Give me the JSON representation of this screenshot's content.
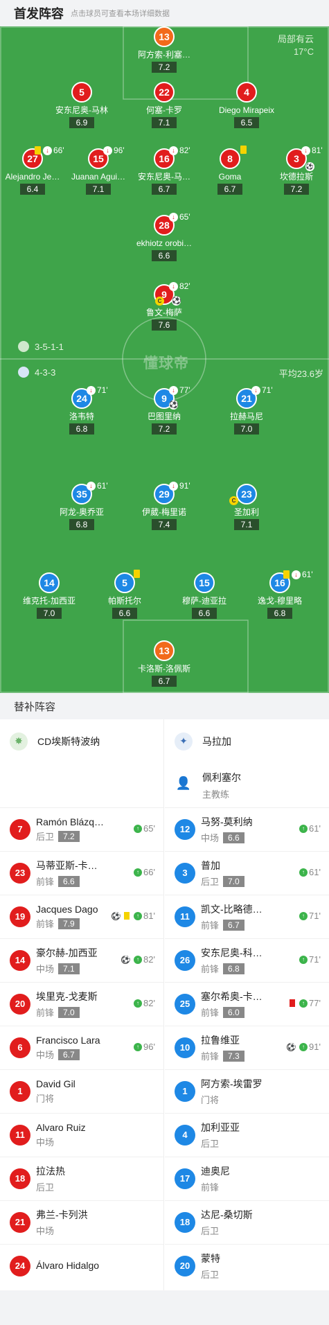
{
  "header": {
    "title": "首发阵容",
    "hint": "点击球员可查看本场详细数据"
  },
  "weather": {
    "condition": "局部有云",
    "temp": "17°C"
  },
  "home": {
    "formation": "3-5-1-1",
    "players": [
      {
        "num": "13",
        "name": "阿方索-利塞…",
        "rating": "7.2",
        "color": "orange"
      },
      {
        "num": "5",
        "name": "安东尼奥-马林",
        "rating": "6.9"
      },
      {
        "num": "22",
        "name": "何塞-卡罗",
        "rating": "7.1"
      },
      {
        "num": "4",
        "name": "Diego Mirapeix",
        "rating": "6.5"
      },
      {
        "num": "27",
        "name": "Alejandro Je…",
        "rating": "6.4",
        "min": "66'"
      },
      {
        "num": "15",
        "name": "Juanan Agui…",
        "rating": "7.1",
        "min": "96'"
      },
      {
        "num": "16",
        "name": "安东尼奥-马…",
        "rating": "6.7",
        "min": "82'"
      },
      {
        "num": "8",
        "name": "Goma",
        "rating": "6.7"
      },
      {
        "num": "3",
        "name": "坎德拉斯",
        "rating": "7.2",
        "min": "81'"
      },
      {
        "num": "28",
        "name": "ekhiotz orobi…",
        "rating": "6.6",
        "min": "65'"
      },
      {
        "num": "9",
        "name": "鲁文-梅萨",
        "rating": "7.6",
        "min": "82'"
      }
    ]
  },
  "away": {
    "formation": "4-3-3",
    "avg_age": "平均23.6岁",
    "players": [
      {
        "num": "24",
        "name": "洛韦特",
        "rating": "6.8",
        "min": "71'"
      },
      {
        "num": "9",
        "name": "巴图里纳",
        "rating": "7.2",
        "min": "77'"
      },
      {
        "num": "21",
        "name": "拉赫马尼",
        "rating": "7.0",
        "min": "71'"
      },
      {
        "num": "35",
        "name": "阿龙-奥乔亚",
        "rating": "6.8",
        "min": "61'"
      },
      {
        "num": "29",
        "name": "伊葳-梅里诺",
        "rating": "7.4",
        "min": "91'"
      },
      {
        "num": "23",
        "name": "圣加利",
        "rating": "7.1"
      },
      {
        "num": "14",
        "name": "维克托-加西亚",
        "rating": "7.0"
      },
      {
        "num": "5",
        "name": "帕斯托尔",
        "rating": "6.6"
      },
      {
        "num": "15",
        "name": "穆萨-迪亚拉",
        "rating": "6.6"
      },
      {
        "num": "16",
        "name": "逸戈-穆里略",
        "rating": "6.8",
        "min": "61'"
      },
      {
        "num": "13",
        "name": "卡洛斯-洛佩斯",
        "rating": "6.7",
        "color": "orange"
      }
    ]
  },
  "watermark": "懂球帝",
  "subs_title": "替补阵容",
  "bench": {
    "home_team": "CD埃斯特波纳",
    "away_team": "马拉加",
    "away_coach": {
      "name": "佩利塞尔",
      "role": "主教练"
    },
    "home_players": [
      {
        "num": "7",
        "name": "Ramón Blázq…",
        "pos": "后卫",
        "rating": "7.2",
        "min": "65'"
      },
      {
        "num": "23",
        "name": "马蒂亚斯-卡…",
        "pos": "前锋",
        "rating": "6.6",
        "min": "66'"
      },
      {
        "num": "19",
        "name": "Jacques Dago",
        "pos": "前锋",
        "rating": "7.9",
        "min": "81'"
      },
      {
        "num": "14",
        "name": "豪尔赫-加西亚",
        "pos": "中场",
        "rating": "7.1",
        "min": "82'"
      },
      {
        "num": "20",
        "name": "埃里克-戈麦斯",
        "pos": "前锋",
        "rating": "7.0",
        "min": "82'"
      },
      {
        "num": "6",
        "name": "Francisco Lara",
        "pos": "中场",
        "rating": "6.7",
        "min": "96'"
      },
      {
        "num": "1",
        "name": "David Gil",
        "pos": "门将"
      },
      {
        "num": "11",
        "name": "Alvaro Ruiz",
        "pos": "中场"
      },
      {
        "num": "18",
        "name": "拉法热",
        "pos": "后卫"
      },
      {
        "num": "21",
        "name": "弗兰-卡列洪",
        "pos": "中场"
      },
      {
        "num": "24",
        "name": "Álvaro Hidalgo",
        "pos": ""
      }
    ],
    "away_players": [
      {
        "num": "12",
        "name": "马努-莫利纳",
        "pos": "中场",
        "rating": "6.6",
        "min": "61'"
      },
      {
        "num": "3",
        "name": "普加",
        "pos": "后卫",
        "rating": "7.0",
        "min": "61'"
      },
      {
        "num": "11",
        "name": "凯文-比略德…",
        "pos": "前锋",
        "rating": "6.7",
        "min": "71'"
      },
      {
        "num": "26",
        "name": "安东尼奥-科…",
        "pos": "前锋",
        "rating": "6.8",
        "min": "71'"
      },
      {
        "num": "25",
        "name": "塞尔希奥-卡…",
        "pos": "前锋",
        "rating": "6.0",
        "min": "77'"
      },
      {
        "num": "10",
        "name": "拉鲁维亚",
        "pos": "前锋",
        "rating": "7.3",
        "min": "91'"
      },
      {
        "num": "1",
        "name": "阿方索-埃雷罗",
        "pos": "门将"
      },
      {
        "num": "4",
        "name": "加利亚亚",
        "pos": "后卫"
      },
      {
        "num": "17",
        "name": "迪奥尼",
        "pos": "前锋"
      },
      {
        "num": "18",
        "name": "达尼-桑切斯",
        "pos": "后卫"
      },
      {
        "num": "20",
        "name": "蒙特",
        "pos": "后卫"
      }
    ]
  }
}
